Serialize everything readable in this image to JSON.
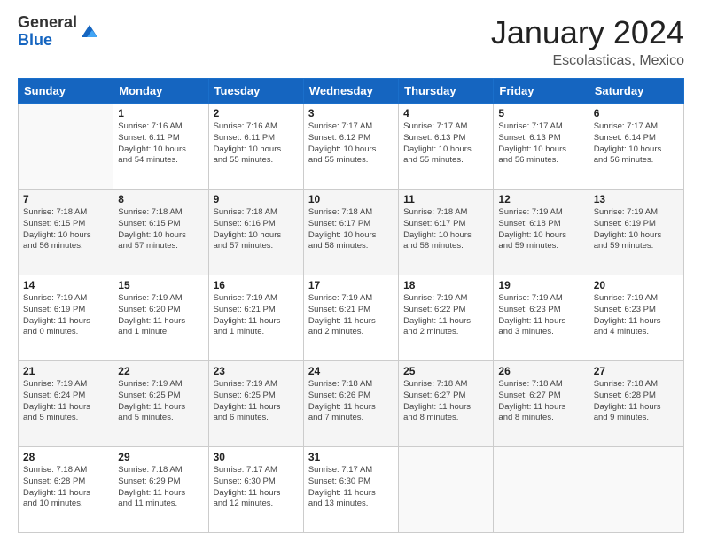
{
  "logo": {
    "general": "General",
    "blue": "Blue"
  },
  "header": {
    "month": "January 2024",
    "location": "Escolasticas, Mexico"
  },
  "weekdays": [
    "Sunday",
    "Monday",
    "Tuesday",
    "Wednesday",
    "Thursday",
    "Friday",
    "Saturday"
  ],
  "weeks": [
    [
      {
        "day": "",
        "info": ""
      },
      {
        "day": "1",
        "info": "Sunrise: 7:16 AM\nSunset: 6:11 PM\nDaylight: 10 hours\nand 54 minutes."
      },
      {
        "day": "2",
        "info": "Sunrise: 7:16 AM\nSunset: 6:11 PM\nDaylight: 10 hours\nand 55 minutes."
      },
      {
        "day": "3",
        "info": "Sunrise: 7:17 AM\nSunset: 6:12 PM\nDaylight: 10 hours\nand 55 minutes."
      },
      {
        "day": "4",
        "info": "Sunrise: 7:17 AM\nSunset: 6:13 PM\nDaylight: 10 hours\nand 55 minutes."
      },
      {
        "day": "5",
        "info": "Sunrise: 7:17 AM\nSunset: 6:13 PM\nDaylight: 10 hours\nand 56 minutes."
      },
      {
        "day": "6",
        "info": "Sunrise: 7:17 AM\nSunset: 6:14 PM\nDaylight: 10 hours\nand 56 minutes."
      }
    ],
    [
      {
        "day": "7",
        "info": "Sunrise: 7:18 AM\nSunset: 6:15 PM\nDaylight: 10 hours\nand 56 minutes."
      },
      {
        "day": "8",
        "info": "Sunrise: 7:18 AM\nSunset: 6:15 PM\nDaylight: 10 hours\nand 57 minutes."
      },
      {
        "day": "9",
        "info": "Sunrise: 7:18 AM\nSunset: 6:16 PM\nDaylight: 10 hours\nand 57 minutes."
      },
      {
        "day": "10",
        "info": "Sunrise: 7:18 AM\nSunset: 6:17 PM\nDaylight: 10 hours\nand 58 minutes."
      },
      {
        "day": "11",
        "info": "Sunrise: 7:18 AM\nSunset: 6:17 PM\nDaylight: 10 hours\nand 58 minutes."
      },
      {
        "day": "12",
        "info": "Sunrise: 7:19 AM\nSunset: 6:18 PM\nDaylight: 10 hours\nand 59 minutes."
      },
      {
        "day": "13",
        "info": "Sunrise: 7:19 AM\nSunset: 6:19 PM\nDaylight: 10 hours\nand 59 minutes."
      }
    ],
    [
      {
        "day": "14",
        "info": "Sunrise: 7:19 AM\nSunset: 6:19 PM\nDaylight: 11 hours\nand 0 minutes."
      },
      {
        "day": "15",
        "info": "Sunrise: 7:19 AM\nSunset: 6:20 PM\nDaylight: 11 hours\nand 1 minute."
      },
      {
        "day": "16",
        "info": "Sunrise: 7:19 AM\nSunset: 6:21 PM\nDaylight: 11 hours\nand 1 minute."
      },
      {
        "day": "17",
        "info": "Sunrise: 7:19 AM\nSunset: 6:21 PM\nDaylight: 11 hours\nand 2 minutes."
      },
      {
        "day": "18",
        "info": "Sunrise: 7:19 AM\nSunset: 6:22 PM\nDaylight: 11 hours\nand 2 minutes."
      },
      {
        "day": "19",
        "info": "Sunrise: 7:19 AM\nSunset: 6:23 PM\nDaylight: 11 hours\nand 3 minutes."
      },
      {
        "day": "20",
        "info": "Sunrise: 7:19 AM\nSunset: 6:23 PM\nDaylight: 11 hours\nand 4 minutes."
      }
    ],
    [
      {
        "day": "21",
        "info": "Sunrise: 7:19 AM\nSunset: 6:24 PM\nDaylight: 11 hours\nand 5 minutes."
      },
      {
        "day": "22",
        "info": "Sunrise: 7:19 AM\nSunset: 6:25 PM\nDaylight: 11 hours\nand 5 minutes."
      },
      {
        "day": "23",
        "info": "Sunrise: 7:19 AM\nSunset: 6:25 PM\nDaylight: 11 hours\nand 6 minutes."
      },
      {
        "day": "24",
        "info": "Sunrise: 7:18 AM\nSunset: 6:26 PM\nDaylight: 11 hours\nand 7 minutes."
      },
      {
        "day": "25",
        "info": "Sunrise: 7:18 AM\nSunset: 6:27 PM\nDaylight: 11 hours\nand 8 minutes."
      },
      {
        "day": "26",
        "info": "Sunrise: 7:18 AM\nSunset: 6:27 PM\nDaylight: 11 hours\nand 8 minutes."
      },
      {
        "day": "27",
        "info": "Sunrise: 7:18 AM\nSunset: 6:28 PM\nDaylight: 11 hours\nand 9 minutes."
      }
    ],
    [
      {
        "day": "28",
        "info": "Sunrise: 7:18 AM\nSunset: 6:28 PM\nDaylight: 11 hours\nand 10 minutes."
      },
      {
        "day": "29",
        "info": "Sunrise: 7:18 AM\nSunset: 6:29 PM\nDaylight: 11 hours\nand 11 minutes."
      },
      {
        "day": "30",
        "info": "Sunrise: 7:17 AM\nSunset: 6:30 PM\nDaylight: 11 hours\nand 12 minutes."
      },
      {
        "day": "31",
        "info": "Sunrise: 7:17 AM\nSunset: 6:30 PM\nDaylight: 11 hours\nand 13 minutes."
      },
      {
        "day": "",
        "info": ""
      },
      {
        "day": "",
        "info": ""
      },
      {
        "day": "",
        "info": ""
      }
    ]
  ]
}
